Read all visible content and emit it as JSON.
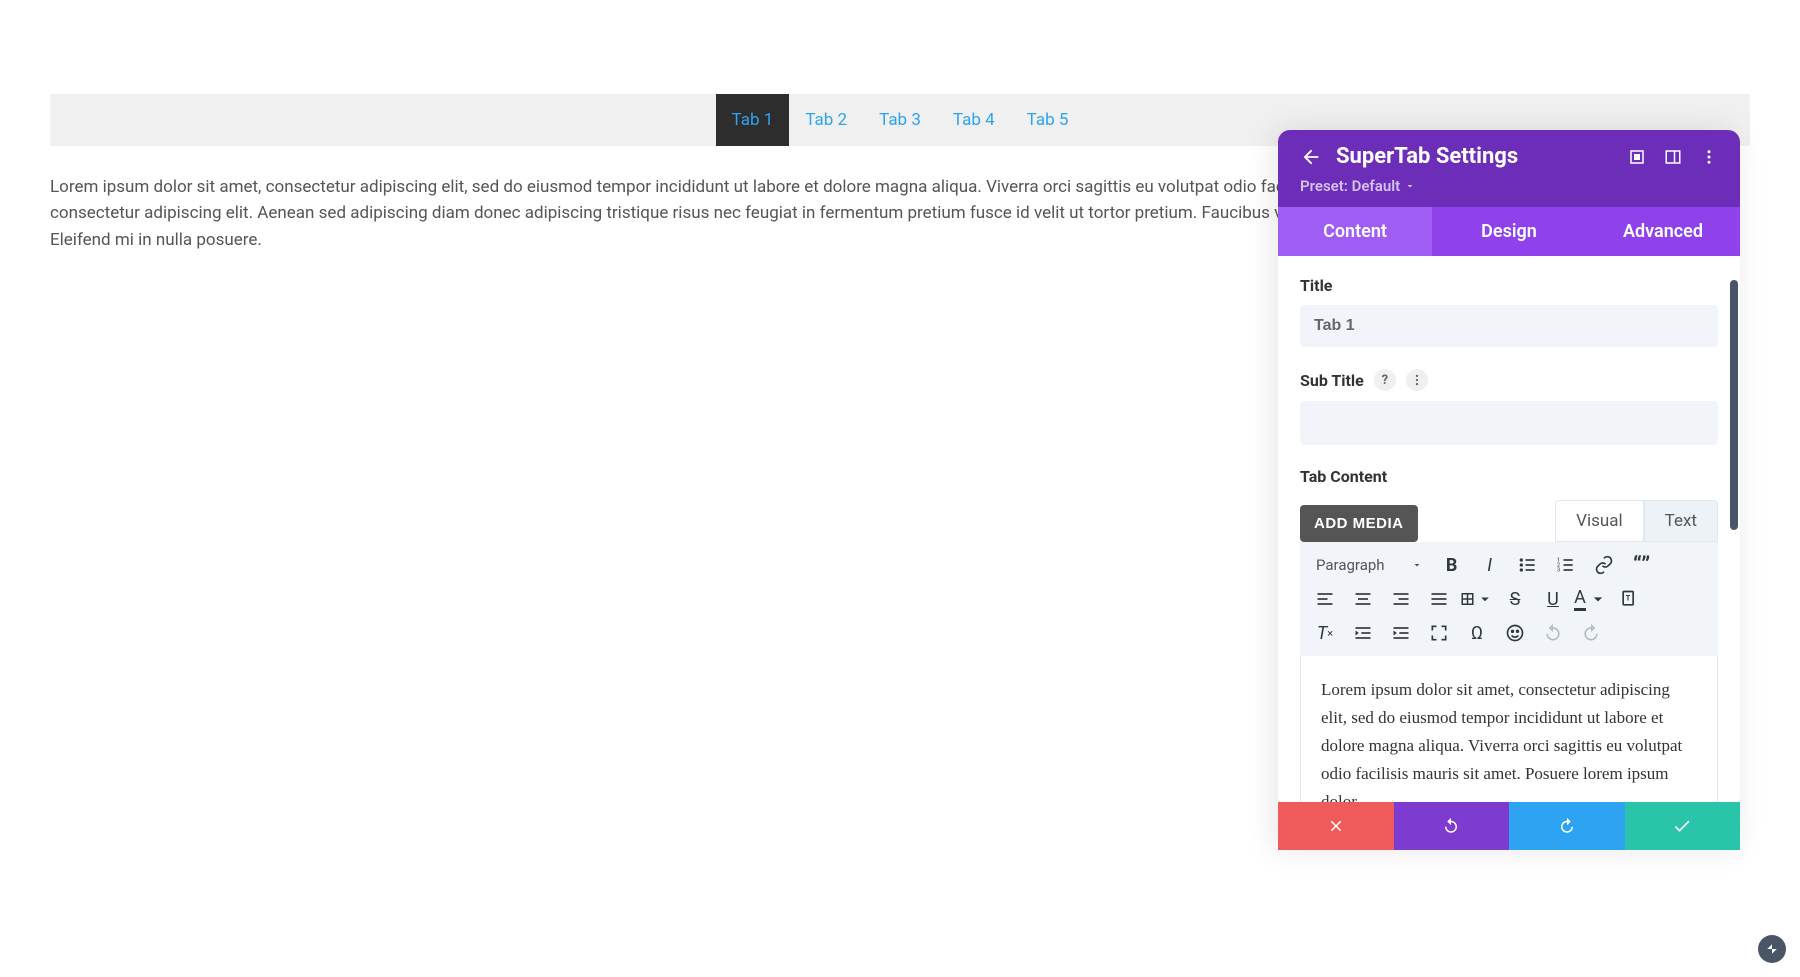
{
  "tabs": [
    {
      "label": "Tab 1",
      "active": true
    },
    {
      "label": "Tab 2",
      "active": false
    },
    {
      "label": "Tab 3",
      "active": false
    },
    {
      "label": "Tab 4",
      "active": false
    },
    {
      "label": "Tab 5",
      "active": false
    }
  ],
  "tab_content_text": "Lorem ipsum dolor sit amet, consectetur adipiscing elit, sed do eiusmod tempor incididunt ut labore et dolore magna aliqua. Viverra orci sagittis eu volutpat odio facilisis mauris sit amet. Posuere lorem ipsum dolor sit amet consectetur adipiscing elit. Aenean sed adipiscing diam donec adipiscing. Fames ac turpis egestas sed tempus urna et pharetra pharetra. Mi quis hendrerit dolor magna eget est lorem. Donec pretium vulputate sapien nec sagittis aliquam malesuada bibendum. Vulputate eu scelerisque felis imperdiet proin fermentum leo vel orci. Pulvinar pellentesque habitant morbi tristique senectus et netus. Egestas pretium aenean pharetra magna ac placerat vestibulum. Faucibus a pellentesque sit amet porttitor eget dolor morbi. Arcu dictum varius duis at consectetur lorem donec massa. Tortor at auctor urna nunc id cursus metus aliquam eleifend. Pretium fusce id velit ut tortor pretium. Faucibus vitae aliquet nec ullamcorper sit amet risus nullam eget. Eleifend mi in nulla posuere sollicitudin aliquam ultrices sagittis orci.",
  "main_paragraph": "Lorem ipsum dolor sit amet, consectetur adipiscing elit, sed do eiusmod tempor incididunt ut labore et dolore magna aliqua. Viverra orci sagittis eu volutpat odio facilisis mauris sit amet. Posuere lorem ipsum dolor sit amet consectetur adipiscing elit. Aenean sed adipiscing diam donec adipiscing tristique risus nec feugiat in fermentum pretium fusce id velit ut tortor pretium. Faucibus vitae aliquet nec ullamcorper sit amet risus nullam eget. Eleifend mi in nulla posuere.",
  "panel": {
    "title": "SuperTab Settings",
    "preset_label": "Preset: Default",
    "tabs": {
      "content": "Content",
      "design": "Design",
      "advanced": "Advanced"
    },
    "fields": {
      "title_label": "Title",
      "title_value": "Tab 1",
      "subtitle_label": "Sub Title",
      "subtitle_value": "",
      "tabcontent_label": "Tab Content"
    },
    "editor": {
      "add_media_label": "ADD MEDIA",
      "visual_tab": "Visual",
      "text_tab": "Text",
      "format_selector": "Paragraph",
      "content": "Lorem ipsum dolor sit amet, consectetur adipiscing elit, sed do eiusmod tempor incididunt ut labore et dolore magna aliqua. Viverra orci sagittis eu volutpat odio facilisis mauris sit amet. Posuere lorem ipsum dolor"
    }
  }
}
